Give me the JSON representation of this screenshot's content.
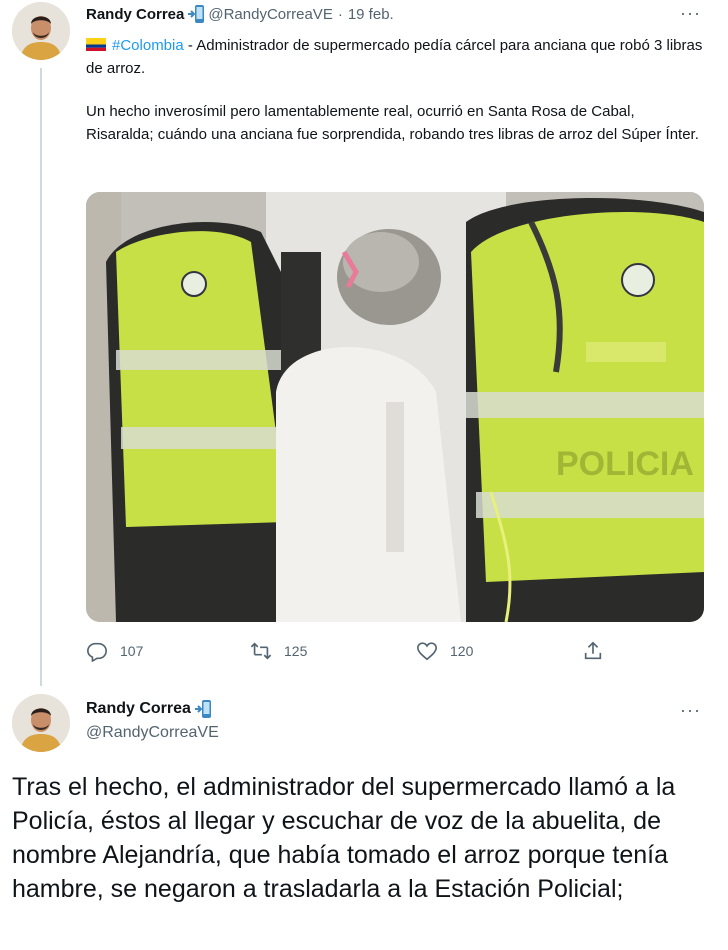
{
  "tweet1": {
    "author_name": "Randy Correa",
    "handle": "@RandyCorreaVE",
    "separator": "·",
    "date": "19 feb.",
    "more_label": "···",
    "hashtag": "#Colombia",
    "headline_rest": " - Administrador de supermercado pedía cárcel para anciana que robó 3 libras de arroz.",
    "body": "Un hecho inverosímil pero lamentablemente real, ocurrió en Santa Rosa de Cabal, Risaralda; cuándo una anciana fue sorprendida, robando tres libras de arroz del Súper Ínter.",
    "photo_vest_text": "POLICIA",
    "replies": "107",
    "retweets": "125",
    "likes": "120"
  },
  "tweet2": {
    "author_name": "Randy Correa",
    "handle": "@RandyCorreaVE",
    "more_label": "···",
    "body": "Tras el hecho, el administrador del supermercado llamó a la Policía, éstos al llegar y escuchar de voz de la abuelita, de nombre Alejandría, que había tomado el arroz porque tenía hambre, se negaron a trasladarla a la Estación Policial;"
  },
  "colors": {
    "link": "#1d9bf0",
    "secondary_text": "#536471",
    "thread_line": "#cfd9de",
    "vest": "#c9e04a"
  },
  "icons": [
    "reply-icon",
    "retweet-icon",
    "like-icon",
    "share-icon",
    "mobile-phone-emoji-icon",
    "colombia-flag-icon"
  ]
}
